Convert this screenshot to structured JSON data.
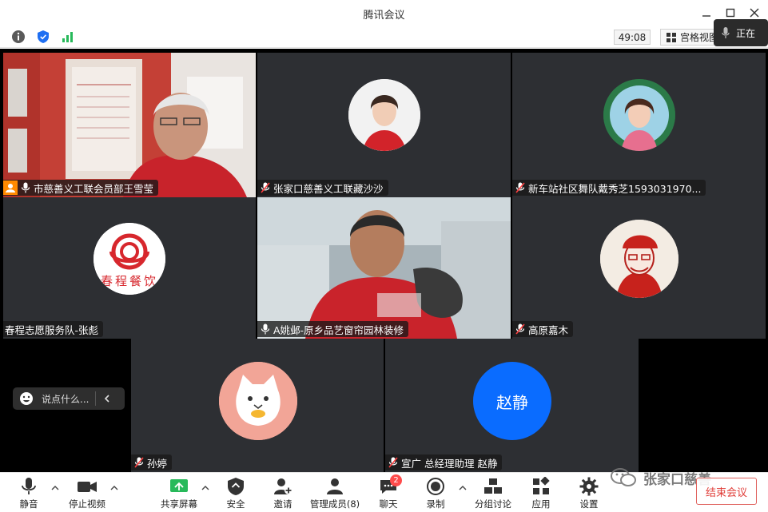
{
  "window": {
    "title": "腾讯会议"
  },
  "statusbar": {
    "timer": "49:08",
    "view_label": "宫格视图",
    "speaking_label": "正在"
  },
  "participants": [
    {
      "name": "市慈善义工联会员部王雪莹"
    },
    {
      "name": "张家口慈善义工联藏沙沙"
    },
    {
      "name": "新车站社区舞队戴秀芝1593031970..."
    },
    {
      "name": "春程志愿服务队-张彪",
      "logo_text": "春程餐饮"
    },
    {
      "name": "A姚邺-原乡品艺窗帘园林装修"
    },
    {
      "name": "高原嘉木"
    },
    {
      "name": "孙婷"
    },
    {
      "name": "宣广 总经理助理 赵静",
      "avatar_text": "赵静"
    }
  ],
  "chat": {
    "placeholder": "说点什么..."
  },
  "toolbar": {
    "mute": "静音",
    "stop_video": "停止视频",
    "share": "共享屏幕",
    "security": "安全",
    "invite": "邀请",
    "members": "管理成员(8)",
    "chat": "聊天",
    "chat_badge": "2",
    "record": "录制",
    "breakout": "分组讨论",
    "apps": "应用",
    "settings": "设置",
    "end": "结束会议"
  },
  "watermark": {
    "text": "张家口慈善"
  },
  "colors": {
    "accent_green": "#23c15b",
    "end_red": "#e03c37",
    "tile_bg": "#2d2f33",
    "blue_avatar": "#0a6cff"
  }
}
